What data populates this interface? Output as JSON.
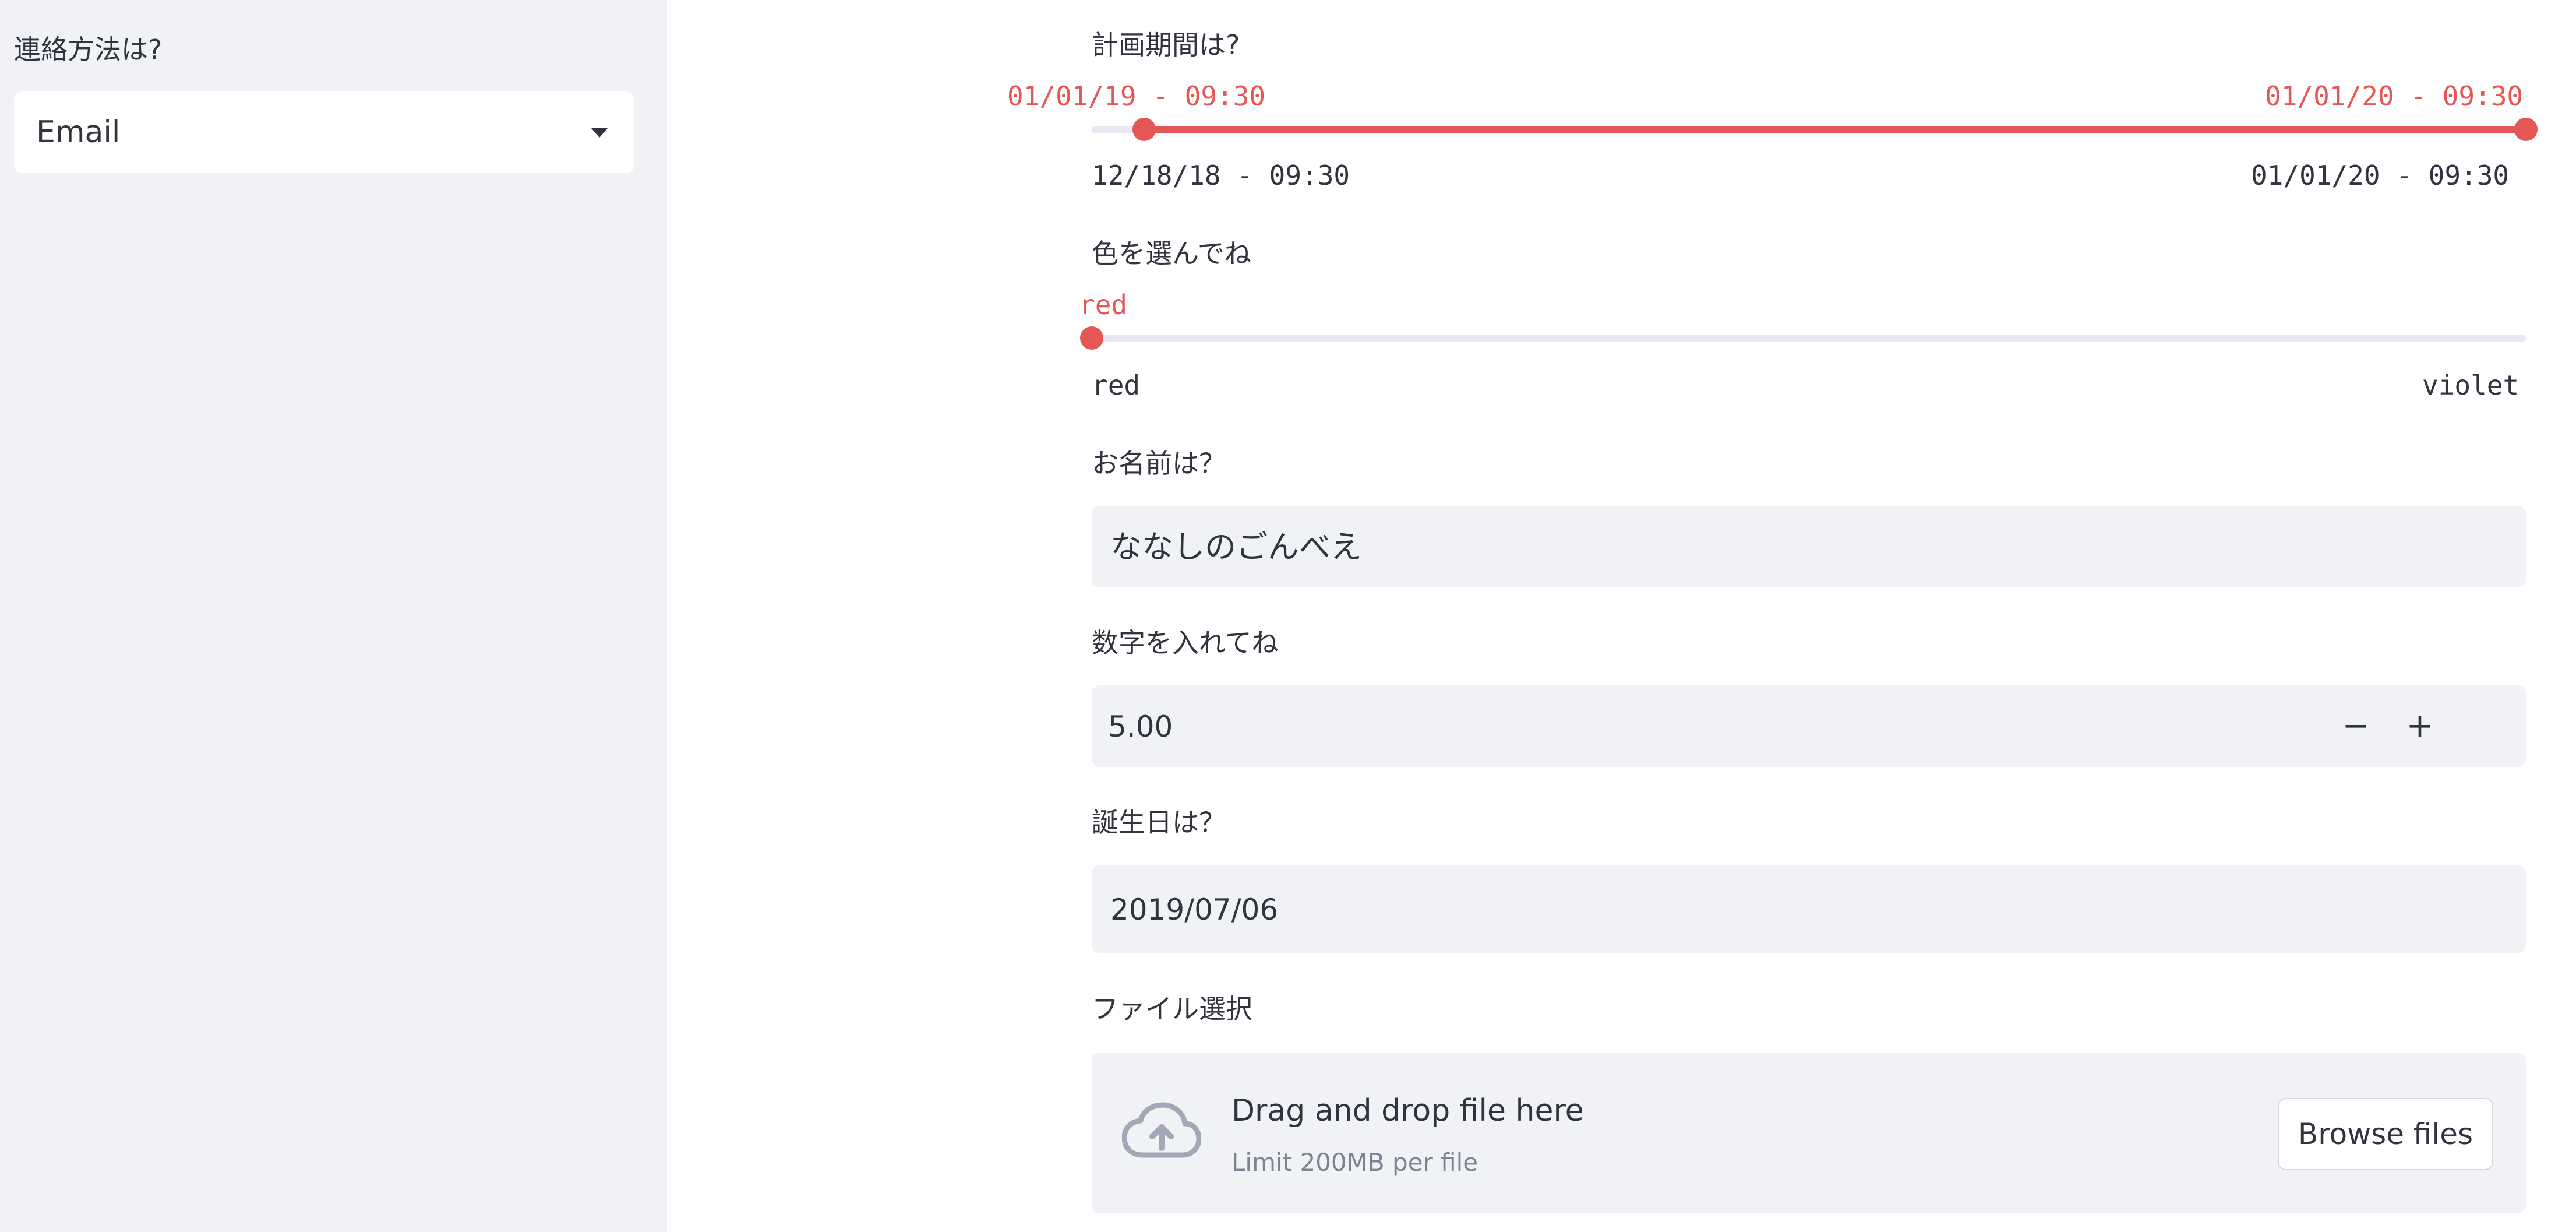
{
  "sidebar": {
    "contact_label": "連絡方法は?",
    "contact_value": "Email",
    "caret_icon": "chevron-down-icon"
  },
  "period_slider": {
    "label": "計画期間は?",
    "start_value": "01/01/19 - 09:30",
    "end_value": "01/01/20 - 09:30",
    "min_label": "12/18/18 - 09:30",
    "max_label": "01/01/20 - 09:30",
    "range_fraction": [
      0.037,
      1.0
    ],
    "accent": "#e45756"
  },
  "color_slider": {
    "label": "色を選んでね",
    "value": "red",
    "min_label": "red",
    "max_label": "violet",
    "fraction": 0.0
  },
  "name_input": {
    "label": "お名前は？",
    "value": "ななしのごんべえ"
  },
  "number_input": {
    "label": "数字を入れてね",
    "value": "5.00",
    "minus": "−",
    "plus": "+"
  },
  "date_input": {
    "label": "誕生日は？",
    "value": "2019/07/06"
  },
  "file_uploader": {
    "label": "ファイル選択",
    "drop_text": "Drag and drop file here",
    "limit_text": "Limit 200MB per file",
    "browse_label": "Browse files",
    "icon": "cloud-upload-icon"
  }
}
